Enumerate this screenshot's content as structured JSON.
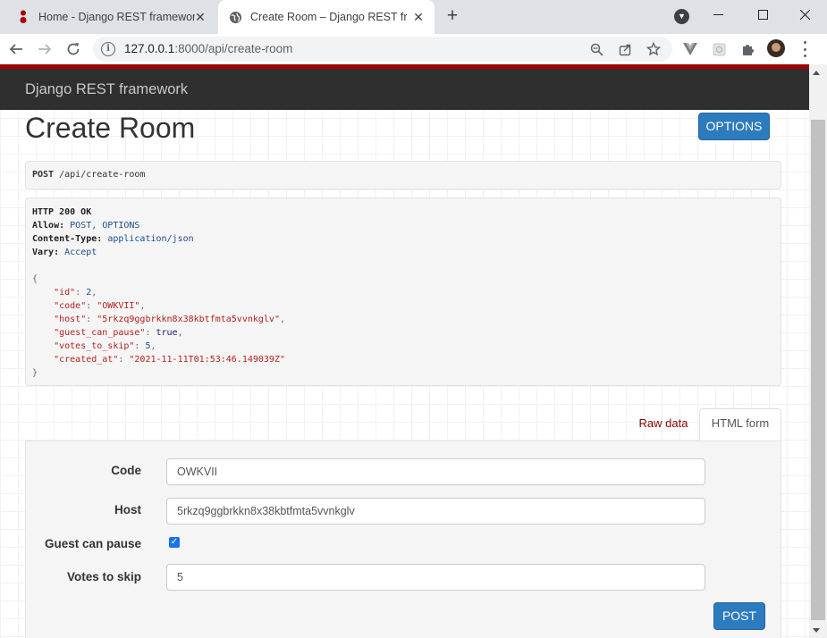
{
  "browser": {
    "tabs": [
      {
        "title": "Home - Django REST framework",
        "close": "✕"
      },
      {
        "title": "Create Room – Django REST framework",
        "close": "✕"
      }
    ],
    "new_tab": "+",
    "address": {
      "host": "127.0.0.1",
      "rest": ":8000/api/create-room"
    }
  },
  "page": {
    "brand": "Django REST framework",
    "title": "Create Room",
    "options_label": "OPTIONS",
    "request": {
      "method": "POST",
      "path": "/api/create-room"
    },
    "response": {
      "status": "HTTP 200 OK",
      "allow_label": "Allow:",
      "allow_value": "POST, OPTIONS",
      "ctype_label": "Content-Type:",
      "ctype_value": "application/json",
      "vary_label": "Vary:",
      "vary_value": "Accept",
      "open": "{",
      "close": "}",
      "fields": [
        {
          "key": "\"id\"",
          "value": "2",
          "kind": "num"
        },
        {
          "key": "\"code\"",
          "value": "\"OWKVII\"",
          "kind": "str"
        },
        {
          "key": "\"host\"",
          "value": "\"5rkzq9ggbrkkn8x38kbtfmta5vvnkglv\"",
          "kind": "str"
        },
        {
          "key": "\"guest_can_pause\"",
          "value": "true",
          "kind": "kw"
        },
        {
          "key": "\"votes_to_skip\"",
          "value": "5",
          "kind": "num"
        },
        {
          "key": "\"created_at\"",
          "value": "\"2021-11-11T01:53:46.149039Z\"",
          "kind": "str"
        }
      ]
    },
    "tabs": {
      "raw": "Raw data",
      "html": "HTML form"
    },
    "form": {
      "code_label": "Code",
      "code_value": "OWKVII",
      "host_label": "Host",
      "host_value": "5rkzq9ggbrkkn8x38kbtfmta5vvnkglv",
      "pause_label": "Guest can pause",
      "pause_checked": true,
      "votes_label": "Votes to skip",
      "votes_value": "5",
      "post_label": "POST"
    }
  },
  "colors": {
    "navbar": "#2f2f2f",
    "accent_red": "#a30000",
    "button_blue": "#2c7bbf"
  }
}
